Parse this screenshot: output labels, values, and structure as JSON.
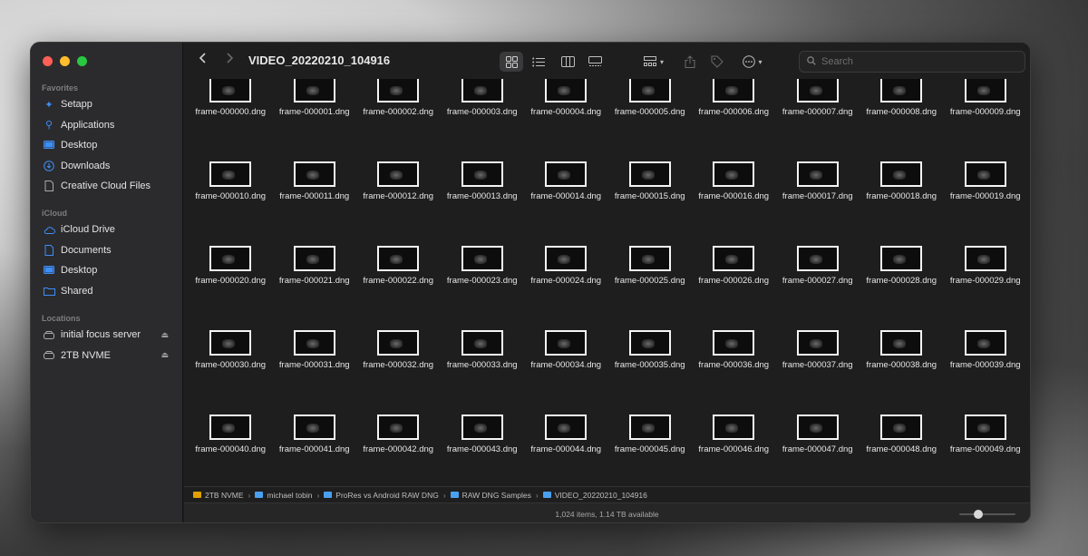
{
  "window": {
    "title": "VIDEO_20220210_104916"
  },
  "sidebar": {
    "sections": [
      {
        "header": "Favorites",
        "items": [
          {
            "label": "Setapp",
            "icon": "setapp-icon"
          },
          {
            "label": "Applications",
            "icon": "applications-icon"
          },
          {
            "label": "Desktop",
            "icon": "desktop-icon"
          },
          {
            "label": "Downloads",
            "icon": "downloads-icon"
          },
          {
            "label": "Creative Cloud Files",
            "icon": "file-icon"
          }
        ]
      },
      {
        "header": "iCloud",
        "items": [
          {
            "label": "iCloud Drive",
            "icon": "cloud-icon"
          },
          {
            "label": "Documents",
            "icon": "document-icon"
          },
          {
            "label": "Desktop",
            "icon": "desktop-icon"
          },
          {
            "label": "Shared",
            "icon": "shared-folder-icon"
          }
        ]
      },
      {
        "header": "Locations",
        "items": [
          {
            "label": "initial focus server",
            "icon": "drive-icon",
            "eject": true
          },
          {
            "label": "2TB NVME",
            "icon": "drive-icon",
            "eject": true
          }
        ]
      }
    ]
  },
  "toolbar": {
    "back_icon": "chevron-left-icon",
    "forward_icon": "chevron-right-icon",
    "view_modes": [
      "icon-view-icon",
      "list-view-icon",
      "column-view-icon",
      "gallery-view-icon"
    ],
    "active_view": "icon-view-icon",
    "search_placeholder": "Search"
  },
  "files": [
    "frame-000000.dng",
    "frame-000001.dng",
    "frame-000002.dng",
    "frame-000003.dng",
    "frame-000004.dng",
    "frame-000005.dng",
    "frame-000006.dng",
    "frame-000007.dng",
    "frame-000008.dng",
    "frame-000009.dng",
    "frame-000010.dng",
    "frame-000011.dng",
    "frame-000012.dng",
    "frame-000013.dng",
    "frame-000014.dng",
    "frame-000015.dng",
    "frame-000016.dng",
    "frame-000017.dng",
    "frame-000018.dng",
    "frame-000019.dng",
    "frame-000020.dng",
    "frame-000021.dng",
    "frame-000022.dng",
    "frame-000023.dng",
    "frame-000024.dng",
    "frame-000025.dng",
    "frame-000026.dng",
    "frame-000027.dng",
    "frame-000028.dng",
    "frame-000029.dng",
    "frame-000030.dng",
    "frame-000031.dng",
    "frame-000032.dng",
    "frame-000033.dng",
    "frame-000034.dng",
    "frame-000035.dng",
    "frame-000036.dng",
    "frame-000037.dng",
    "frame-000038.dng",
    "frame-000039.dng",
    "frame-000040.dng",
    "frame-000041.dng",
    "frame-000042.dng",
    "frame-000043.dng",
    "frame-000044.dng",
    "frame-000045.dng",
    "frame-000046.dng",
    "frame-000047.dng",
    "frame-000048.dng",
    "frame-000049.dng"
  ],
  "pathbar": [
    {
      "label": "2TB NVME",
      "color": "#e0a000"
    },
    {
      "label": "michael tobin",
      "color": "#4aa0f0"
    },
    {
      "label": "ProRes vs Android RAW DNG",
      "color": "#4aa0f0"
    },
    {
      "label": "RAW DNG Samples",
      "color": "#4aa0f0"
    },
    {
      "label": "VIDEO_20220210_104916",
      "color": "#4aa0f0"
    }
  ],
  "status": {
    "text": "1,024 items, 1.14 TB available",
    "icon_size_fraction": 0.3
  },
  "colors": {
    "accent": "#3e8ef7",
    "close": "#fe5f57",
    "minimize": "#febc2e",
    "zoom": "#28c840"
  }
}
